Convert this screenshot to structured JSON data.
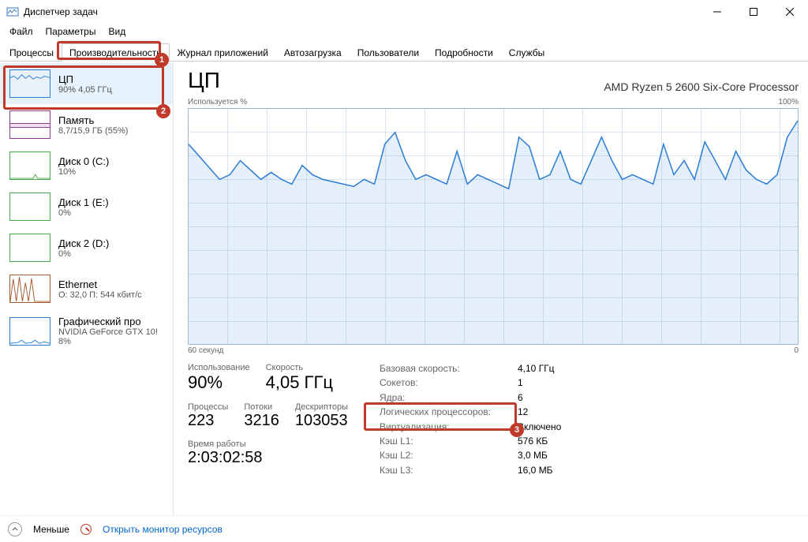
{
  "window": {
    "title": "Диспетчер задач"
  },
  "menu": {
    "file": "Файл",
    "options": "Параметры",
    "view": "Вид"
  },
  "tabs": {
    "processes": "Процессы",
    "performance": "Производительность",
    "apphistory": "Журнал приложений",
    "startup": "Автозагрузка",
    "users": "Пользователи",
    "details": "Подробности",
    "services": "Службы"
  },
  "sidebar": {
    "cpu": {
      "title": "ЦП",
      "sub": "90% 4,05 ГГц"
    },
    "mem": {
      "title": "Память",
      "sub": "8,7/15,9 ГБ (55%)"
    },
    "disk0": {
      "title": "Диск 0 (C:)",
      "sub": "10%"
    },
    "disk1": {
      "title": "Диск 1 (E:)",
      "sub": "0%"
    },
    "disk2": {
      "title": "Диск 2 (D:)",
      "sub": "0%"
    },
    "eth": {
      "title": "Ethernet",
      "sub": "О: 32,0 П: 544 кбит/с"
    },
    "gpu": {
      "title": "Графический про",
      "sub": "NVIDIA GeForce GTX 10!",
      "sub2": "8%"
    }
  },
  "main": {
    "title": "ЦП",
    "model": "AMD Ryzen 5 2600 Six-Core Processor",
    "ylabel": "Используется %",
    "ymax": "100%",
    "xlabel_left": "60 секунд",
    "xlabel_right": "0",
    "stats_left": {
      "usage_lbl": "Использование",
      "usage_val": "90%",
      "speed_lbl": "Скорость",
      "speed_val": "4,05 ГГц",
      "proc_lbl": "Процессы",
      "proc_val": "223",
      "thr_lbl": "Потоки",
      "thr_val": "3216",
      "hnd_lbl": "Дескрипторы",
      "hnd_val": "103053",
      "up_lbl": "Время работы",
      "up_val": "2:03:02:58"
    },
    "stats_right": {
      "base_k": "Базовая скорость:",
      "base_v": "4,10 ГГц",
      "sock_k": "Сокетов:",
      "sock_v": "1",
      "cores_k": "Ядра:",
      "cores_v": "6",
      "lp_k": "Логических процессоров:",
      "lp_v": "12",
      "virt_k": "Виртуализация:",
      "virt_v": "Включено",
      "l1_k": "Кэш L1:",
      "l1_v": "576 КБ",
      "l2_k": "Кэш L2:",
      "l2_v": "3,0 МБ",
      "l3_k": "Кэш L3:",
      "l3_v": "16,0 МБ"
    }
  },
  "footer": {
    "less": "Меньше",
    "open_rm": "Открыть монитор ресурсов"
  },
  "callouts": {
    "b1": "1",
    "b2": "2",
    "b3": "3"
  },
  "chart_data": {
    "type": "line",
    "title": "ЦП — Используется %",
    "xlabel": "60 секунд",
    "ylabel": "Используется %",
    "ylim": [
      0,
      100
    ],
    "xrange_seconds": [
      60,
      0
    ],
    "values": [
      85,
      80,
      75,
      70,
      72,
      78,
      74,
      70,
      73,
      70,
      68,
      76,
      72,
      70,
      69,
      68,
      67,
      70,
      68,
      85,
      90,
      78,
      70,
      72,
      70,
      68,
      82,
      68,
      72,
      70,
      68,
      66,
      88,
      84,
      70,
      72,
      82,
      70,
      68,
      78,
      88,
      78,
      70,
      72,
      70,
      68,
      85,
      72,
      78,
      70,
      86,
      78,
      70,
      82,
      74,
      70,
      68,
      72,
      88,
      95
    ]
  }
}
